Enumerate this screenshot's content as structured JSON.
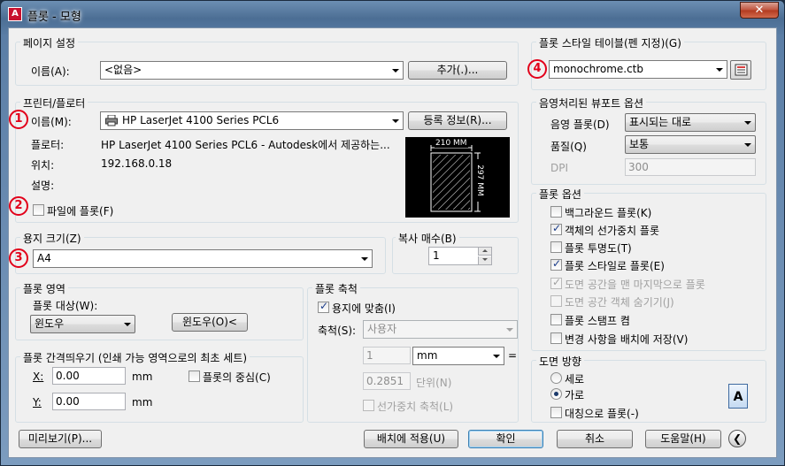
{
  "window": {
    "title": "플롯 - 모형",
    "close_glyph": "✕",
    "app_icon_glyph": "A"
  },
  "page_setup": {
    "title": "페이지 설정",
    "name_label": "이름(A):",
    "name_value": "<없음>",
    "add_button": "추가(.)..."
  },
  "printer": {
    "title": "프린터/플로터",
    "name_label": "이름(M):",
    "name_value": "HP LaserJet 4100 Series PCL6",
    "properties_button": "등록 정보(R)...",
    "plotter_label": "플로터:",
    "plotter_value": "HP LaserJet 4100 Series PCL6 - Autodesk에서 제공하는...",
    "location_label": "위치:",
    "location_value": "192.168.0.18",
    "description_label": "설명:",
    "plot_to_file_label": "파일에 플롯(F)",
    "plot_to_file_checked": false,
    "preview_width": "210 MM",
    "preview_height": "297 MM"
  },
  "paper_size": {
    "title": "용지 크기(Z)",
    "value": "A4"
  },
  "copies": {
    "title": "복사 매수(B)",
    "value": "1"
  },
  "plot_area": {
    "title": "플롯 영역",
    "what_label": "플롯 대상(W):",
    "what_value": "윈도우",
    "window_button": "윈도우(O)<"
  },
  "plot_offset": {
    "title": "플롯 간격띄우기 (인쇄 가능 영역으로의 최초 세트)",
    "x_label": "X:",
    "x_value": "0.00",
    "y_label": "Y:",
    "y_value": "0.00",
    "unit": "mm",
    "center_label": "플롯의 중심(C)",
    "center_checked": false
  },
  "plot_scale": {
    "title": "플롯 축척",
    "fit_label": "용지에 맞춤(I)",
    "fit_checked": true,
    "scale_label": "축척(S):",
    "scale_value": "사용자",
    "value1": "1",
    "unit_value": "mm",
    "equals": "=",
    "value2": "0.2851",
    "unit_label": "단위(N)",
    "lineweights_label": "선가중치 축척(L)",
    "lineweights_checked": false
  },
  "plot_style_table": {
    "title": "플롯 스타일 테이블(펜 지정)(G)",
    "value": "monochrome.ctb"
  },
  "shaded_viewport": {
    "title": "음영처리된 뷰포트 옵션",
    "shade_label": "음영 플롯(D)",
    "shade_value": "표시되는 대로",
    "quality_label": "품질(Q)",
    "quality_value": "보통",
    "dpi_label": "DPI",
    "dpi_value": "300"
  },
  "plot_options": {
    "title": "플롯 옵션",
    "items": [
      {
        "label": "백그라운드 플롯(K)",
        "checked": false,
        "disabled": false
      },
      {
        "label": "객체의 선가중치 플롯",
        "checked": true,
        "disabled": false
      },
      {
        "label": "플롯 투명도(T)",
        "checked": false,
        "disabled": false
      },
      {
        "label": "플롯 스타일로 플롯(E)",
        "checked": true,
        "disabled": false
      },
      {
        "label": "도면 공간을 맨 마지막으로 플롯",
        "checked": true,
        "disabled": true
      },
      {
        "label": "도면 공간 객체 숨기기(J)",
        "checked": false,
        "disabled": true
      },
      {
        "label": "플롯 스탬프 켬",
        "checked": false,
        "disabled": false
      },
      {
        "label": "변경 사항을 배치에 저장(V)",
        "checked": false,
        "disabled": false
      }
    ]
  },
  "drawing_orientation": {
    "title": "도면 방향",
    "portrait_label": "세로",
    "landscape_label": "가로",
    "selected": "landscape",
    "upside_down_label": "대칭으로 플롯(-)",
    "upside_down_checked": false,
    "icon_glyph": "A"
  },
  "footer": {
    "preview_button": "미리보기(P)...",
    "apply_button": "배치에 적용(U)",
    "ok_button": "확인",
    "cancel_button": "취소",
    "help_button": "도움말(H)",
    "collapse_glyph": "❮"
  },
  "annotations": [
    "1",
    "2",
    "3",
    "4"
  ],
  "colors": {
    "annotation": "#e2001a",
    "dialog_bg": "#f0f0f0",
    "frame": "#5b7ea6"
  }
}
